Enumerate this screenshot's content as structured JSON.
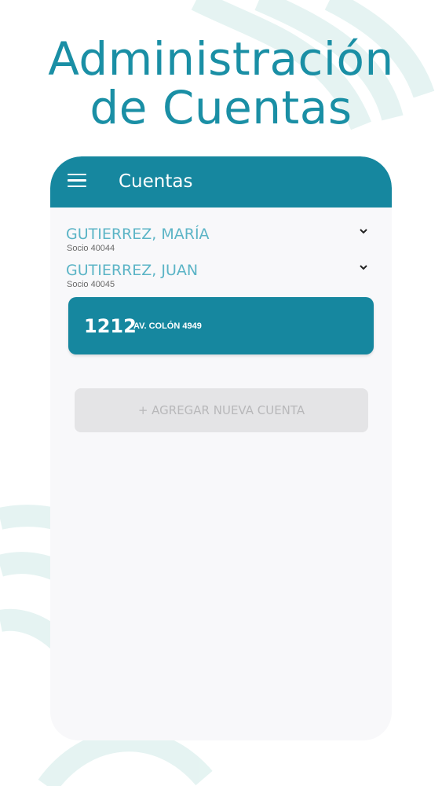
{
  "header": {
    "title_line1": "Administración",
    "title_line2": "de Cuentas"
  },
  "appbar": {
    "title": "Cuentas",
    "menu_icon": "hamburger-menu-icon"
  },
  "members": [
    {
      "name": "GUTIERREZ, MARÍA",
      "subtitle": "Socio 40044",
      "icon": "chevron-down-icon"
    },
    {
      "name": "GUTIERREZ, JUAN",
      "subtitle": "Socio 40045",
      "icon": "chevron-down-icon"
    }
  ],
  "account": {
    "number": "1212",
    "address": "AV. COLÓN 4949"
  },
  "add_account_label": "+ AGREGAR NUEVA CUENTA",
  "colors": {
    "primary": "#16879f",
    "title_teal": "#1a8fa5",
    "member_name": "#5bb4c6",
    "screen_bg": "#f8f8fa",
    "disabled_button": "#e4e4e6"
  }
}
